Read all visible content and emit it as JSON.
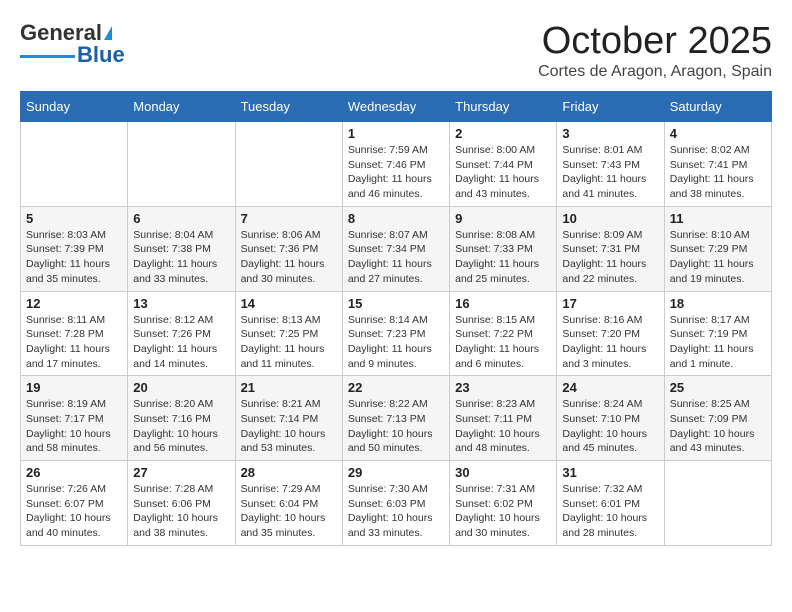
{
  "header": {
    "logo_general": "General",
    "logo_blue": "Blue",
    "month": "October 2025",
    "location": "Cortes de Aragon, Aragon, Spain"
  },
  "weekdays": [
    "Sunday",
    "Monday",
    "Tuesday",
    "Wednesday",
    "Thursday",
    "Friday",
    "Saturday"
  ],
  "weeks": [
    [
      {
        "day": "",
        "info": ""
      },
      {
        "day": "",
        "info": ""
      },
      {
        "day": "",
        "info": ""
      },
      {
        "day": "1",
        "info": "Sunrise: 7:59 AM\nSunset: 7:46 PM\nDaylight: 11 hours and 46 minutes."
      },
      {
        "day": "2",
        "info": "Sunrise: 8:00 AM\nSunset: 7:44 PM\nDaylight: 11 hours and 43 minutes."
      },
      {
        "day": "3",
        "info": "Sunrise: 8:01 AM\nSunset: 7:43 PM\nDaylight: 11 hours and 41 minutes."
      },
      {
        "day": "4",
        "info": "Sunrise: 8:02 AM\nSunset: 7:41 PM\nDaylight: 11 hours and 38 minutes."
      }
    ],
    [
      {
        "day": "5",
        "info": "Sunrise: 8:03 AM\nSunset: 7:39 PM\nDaylight: 11 hours and 35 minutes."
      },
      {
        "day": "6",
        "info": "Sunrise: 8:04 AM\nSunset: 7:38 PM\nDaylight: 11 hours and 33 minutes."
      },
      {
        "day": "7",
        "info": "Sunrise: 8:06 AM\nSunset: 7:36 PM\nDaylight: 11 hours and 30 minutes."
      },
      {
        "day": "8",
        "info": "Sunrise: 8:07 AM\nSunset: 7:34 PM\nDaylight: 11 hours and 27 minutes."
      },
      {
        "day": "9",
        "info": "Sunrise: 8:08 AM\nSunset: 7:33 PM\nDaylight: 11 hours and 25 minutes."
      },
      {
        "day": "10",
        "info": "Sunrise: 8:09 AM\nSunset: 7:31 PM\nDaylight: 11 hours and 22 minutes."
      },
      {
        "day": "11",
        "info": "Sunrise: 8:10 AM\nSunset: 7:29 PM\nDaylight: 11 hours and 19 minutes."
      }
    ],
    [
      {
        "day": "12",
        "info": "Sunrise: 8:11 AM\nSunset: 7:28 PM\nDaylight: 11 hours and 17 minutes."
      },
      {
        "day": "13",
        "info": "Sunrise: 8:12 AM\nSunset: 7:26 PM\nDaylight: 11 hours and 14 minutes."
      },
      {
        "day": "14",
        "info": "Sunrise: 8:13 AM\nSunset: 7:25 PM\nDaylight: 11 hours and 11 minutes."
      },
      {
        "day": "15",
        "info": "Sunrise: 8:14 AM\nSunset: 7:23 PM\nDaylight: 11 hours and 9 minutes."
      },
      {
        "day": "16",
        "info": "Sunrise: 8:15 AM\nSunset: 7:22 PM\nDaylight: 11 hours and 6 minutes."
      },
      {
        "day": "17",
        "info": "Sunrise: 8:16 AM\nSunset: 7:20 PM\nDaylight: 11 hours and 3 minutes."
      },
      {
        "day": "18",
        "info": "Sunrise: 8:17 AM\nSunset: 7:19 PM\nDaylight: 11 hours and 1 minute."
      }
    ],
    [
      {
        "day": "19",
        "info": "Sunrise: 8:19 AM\nSunset: 7:17 PM\nDaylight: 10 hours and 58 minutes."
      },
      {
        "day": "20",
        "info": "Sunrise: 8:20 AM\nSunset: 7:16 PM\nDaylight: 10 hours and 56 minutes."
      },
      {
        "day": "21",
        "info": "Sunrise: 8:21 AM\nSunset: 7:14 PM\nDaylight: 10 hours and 53 minutes."
      },
      {
        "day": "22",
        "info": "Sunrise: 8:22 AM\nSunset: 7:13 PM\nDaylight: 10 hours and 50 minutes."
      },
      {
        "day": "23",
        "info": "Sunrise: 8:23 AM\nSunset: 7:11 PM\nDaylight: 10 hours and 48 minutes."
      },
      {
        "day": "24",
        "info": "Sunrise: 8:24 AM\nSunset: 7:10 PM\nDaylight: 10 hours and 45 minutes."
      },
      {
        "day": "25",
        "info": "Sunrise: 8:25 AM\nSunset: 7:09 PM\nDaylight: 10 hours and 43 minutes."
      }
    ],
    [
      {
        "day": "26",
        "info": "Sunrise: 7:26 AM\nSunset: 6:07 PM\nDaylight: 10 hours and 40 minutes."
      },
      {
        "day": "27",
        "info": "Sunrise: 7:28 AM\nSunset: 6:06 PM\nDaylight: 10 hours and 38 minutes."
      },
      {
        "day": "28",
        "info": "Sunrise: 7:29 AM\nSunset: 6:04 PM\nDaylight: 10 hours and 35 minutes."
      },
      {
        "day": "29",
        "info": "Sunrise: 7:30 AM\nSunset: 6:03 PM\nDaylight: 10 hours and 33 minutes."
      },
      {
        "day": "30",
        "info": "Sunrise: 7:31 AM\nSunset: 6:02 PM\nDaylight: 10 hours and 30 minutes."
      },
      {
        "day": "31",
        "info": "Sunrise: 7:32 AM\nSunset: 6:01 PM\nDaylight: 10 hours and 28 minutes."
      },
      {
        "day": "",
        "info": ""
      }
    ]
  ]
}
